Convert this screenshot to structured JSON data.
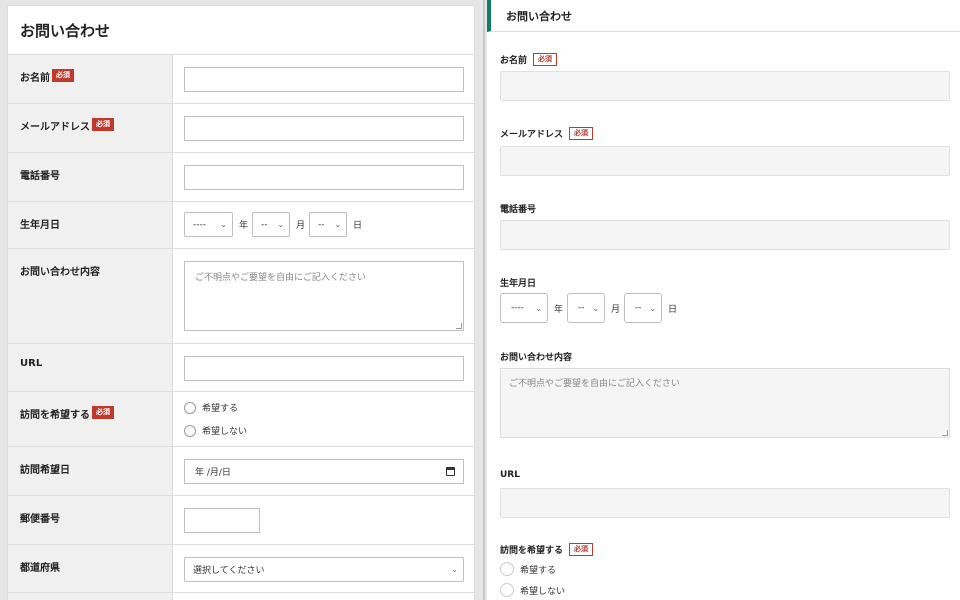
{
  "left_form": {
    "title": "お問い合わせ",
    "required_badge": "必須",
    "fields": {
      "name": {
        "label": "お名前"
      },
      "email": {
        "label": "メールアドレス"
      },
      "phone": {
        "label": "電話番号"
      },
      "birthday": {
        "label": "生年月日",
        "year_value": "----",
        "month_value": "--",
        "day_value": "--",
        "year_unit": "年",
        "month_unit": "月",
        "day_unit": "日"
      },
      "inquiry": {
        "label": "お問い合わせ内容",
        "placeholder": "ご不明点やご要望を自由にご記入ください"
      },
      "url": {
        "label": "URL"
      },
      "visit": {
        "label": "訪問を希望する",
        "options": [
          "希望する",
          "希望しない"
        ]
      },
      "visit_date": {
        "label": "訪問希望日",
        "value": "年 /月/日"
      },
      "postal": {
        "label": "郵便番号"
      },
      "prefecture": {
        "label": "都道府県",
        "value": "選択してください"
      }
    }
  },
  "right_form": {
    "title": "お問い合わせ",
    "required_badge": "必須",
    "fields": {
      "name": {
        "label": "お名前"
      },
      "email": {
        "label": "メールアドレス"
      },
      "phone": {
        "label": "電話番号"
      },
      "birthday": {
        "label": "生年月日",
        "year_value": "----",
        "month_value": "--",
        "day_value": "--",
        "year_unit": "年",
        "month_unit": "月",
        "day_unit": "日"
      },
      "inquiry": {
        "label": "お問い合わせ内容",
        "placeholder": "ご不明点やご要望を自由にご記入ください"
      },
      "url": {
        "label": "URL"
      },
      "visit": {
        "label": "訪問を希望する",
        "options": [
          "希望する",
          "希望しない"
        ]
      }
    }
  },
  "colors": {
    "required_red": "#c0392b",
    "accent_green": "#117a65"
  }
}
